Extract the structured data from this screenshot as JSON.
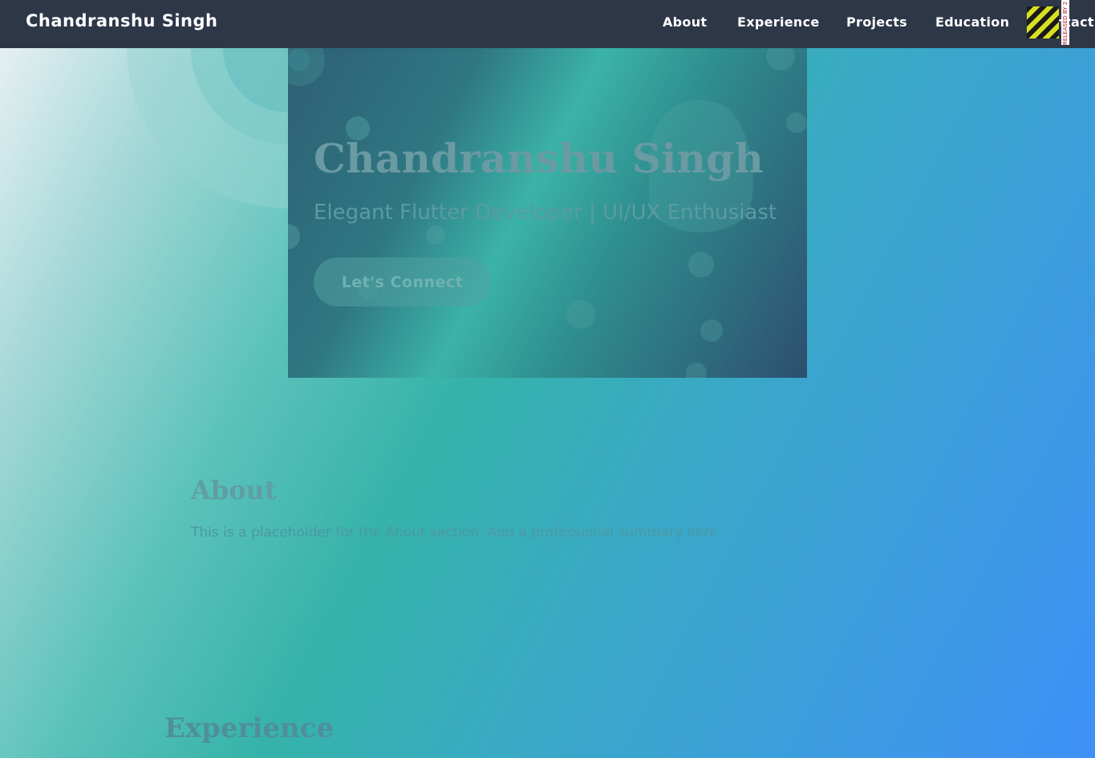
{
  "navbar": {
    "brand": "Chandranshu Singh",
    "links": [
      {
        "label": "About"
      },
      {
        "label": "Experience"
      },
      {
        "label": "Projects"
      },
      {
        "label": "Education"
      },
      {
        "label": "Contact"
      }
    ],
    "debug_banner": "RELEASED BY 2"
  },
  "hero": {
    "title": "Chandranshu Singh",
    "subtitle": "Elegant Flutter Developer | UI/UX Enthusiast",
    "cta_label": "Let's Connect"
  },
  "about": {
    "heading": "About",
    "text": "This is a placeholder for the About section. Add a professional summary here."
  },
  "experience": {
    "heading": "Experience"
  },
  "colors": {
    "navbar_bg": "#2d3748",
    "accent_teal": "#38b2ac",
    "accent_blue": "#3f90f8",
    "nav_text": "#ffffff"
  }
}
